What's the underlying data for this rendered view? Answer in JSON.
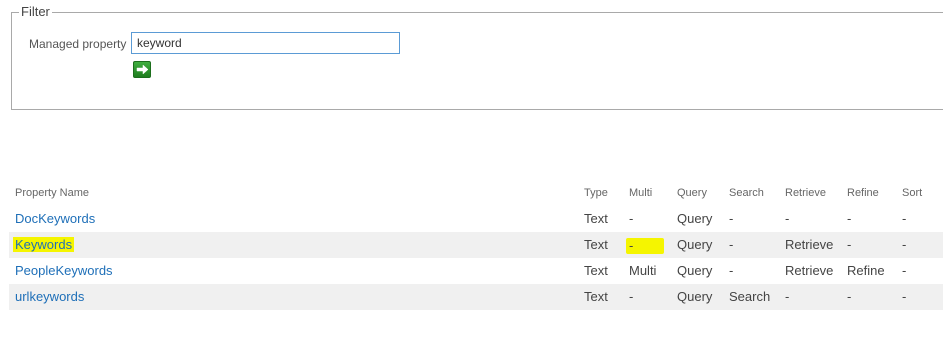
{
  "filter": {
    "legend": "Filter",
    "managed_property_label": "Managed property",
    "managed_property_value": "keyword"
  },
  "table": {
    "headers": {
      "name": "Property Name",
      "type": "Type",
      "multi": "Multi",
      "query": "Query",
      "search": "Search",
      "retrieve": "Retrieve",
      "refine": "Refine",
      "sort": "Sort"
    },
    "rows": [
      {
        "name": "DocKeywords",
        "type": "Text",
        "multi": "-",
        "query": "Query",
        "search": "-",
        "retrieve": "-",
        "refine": "-",
        "sort": "-"
      },
      {
        "name": "Keywords",
        "type": "Text",
        "multi": "-",
        "query": "Query",
        "search": "-",
        "retrieve": "Retrieve",
        "refine": "-",
        "sort": "-"
      },
      {
        "name": "PeopleKeywords",
        "type": "Text",
        "multi": "Multi",
        "query": "Query",
        "search": "-",
        "retrieve": "Retrieve",
        "refine": "Refine",
        "sort": "-"
      },
      {
        "name": "urlkeywords",
        "type": "Text",
        "multi": "-",
        "query": "Query",
        "search": "Search",
        "retrieve": "-",
        "refine": "-",
        "sort": "-"
      }
    ]
  },
  "colors": {
    "link": "#1e6fb8",
    "highlight": "#f5f500",
    "alt_row": "#f0f0f0",
    "go_button": "#2e8b2e"
  },
  "icons": {
    "go": "arrow-right-icon"
  }
}
